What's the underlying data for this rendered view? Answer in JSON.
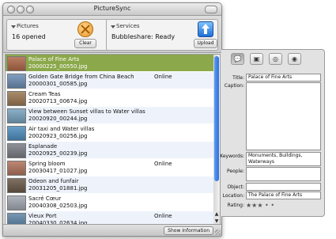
{
  "window": {
    "title": "PictureSync"
  },
  "toolbar": {
    "pictures_label": "Pictures",
    "pictures_value": "16 opened",
    "clear_label": "Clear",
    "services_label": "Services",
    "services_value": "Bubbleshare: Ready",
    "upload_label": "Upload"
  },
  "list": {
    "rows": [
      {
        "title": "Palace of Fine Arts",
        "file": "20000225_00550.jpg",
        "status": "",
        "selected": true,
        "thumb": "#b06a4a"
      },
      {
        "title": "Golden Gate Bridge from China Beach",
        "file": "20000301_00585.jpg",
        "status": "Online",
        "selected": false,
        "thumb": "#6e8fb5"
      },
      {
        "title": "Cream Teas",
        "file": "20020713_00674.jpg",
        "status": "",
        "selected": false,
        "thumb": "#9c7a55"
      },
      {
        "title": "View between Sunset villas to Water villas",
        "file": "20020920_00244.jpg",
        "status": "",
        "selected": false,
        "thumb": "#79a4bf"
      },
      {
        "title": "Air taxi and Water villas",
        "file": "20020923_00256.jpg",
        "status": "",
        "selected": false,
        "thumb": "#4f8fbf"
      },
      {
        "title": "Esplanade",
        "file": "20020925_00239.jpg",
        "status": "",
        "selected": false,
        "thumb": "#7c7f86"
      },
      {
        "title": "Spring bloom",
        "file": "20030417_01027.jpg",
        "status": "Online",
        "selected": false,
        "thumb": "#b2755f"
      },
      {
        "title": "Odeon and funfair",
        "file": "20031205_01881.jpg",
        "status": "",
        "selected": false,
        "thumb": "#6b5a4a"
      },
      {
        "title": "Sacré Cœur",
        "file": "20040308_02503.jpg",
        "status": "",
        "selected": false,
        "thumb": "#a3a9b3"
      },
      {
        "title": "Vieux Port",
        "file": "20040330_02634.jpg",
        "status": "Online",
        "selected": false,
        "thumb": "#5f86a8"
      }
    ]
  },
  "show_info_label": "Show Information",
  "info": {
    "title_label": "Title:",
    "title_value": "Palace of Fine Arts",
    "caption_label": "Caption:",
    "caption_value": "",
    "keywords_label": "Keywords:",
    "keywords_value": "Monuments, Buildings, Waterways",
    "people_label": "People:",
    "people_value": "",
    "object_label": "Object:",
    "object_value": "",
    "location_label": "Location:",
    "location_value": "The Palace of Fine Arts",
    "rating_label": "Rating:",
    "rating_value": "★★★ • •",
    "rating_stars": 3
  }
}
